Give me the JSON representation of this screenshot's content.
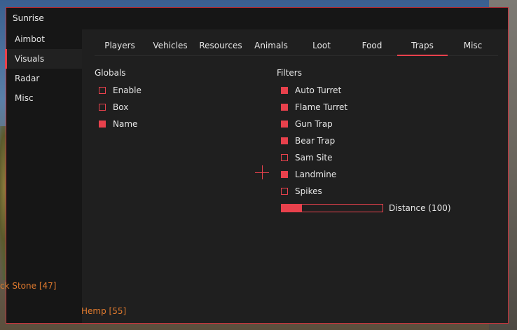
{
  "window": {
    "title": "Sunrise"
  },
  "sidebar": {
    "items": [
      {
        "label": "Aimbot",
        "active": false
      },
      {
        "label": "Visuals",
        "active": true
      },
      {
        "label": "Radar",
        "active": false
      },
      {
        "label": "Misc",
        "active": false
      }
    ]
  },
  "tabs": [
    {
      "label": "Players",
      "active": false
    },
    {
      "label": "Vehicles",
      "active": false
    },
    {
      "label": "Resources",
      "active": false
    },
    {
      "label": "Animals",
      "active": false
    },
    {
      "label": "Loot",
      "active": false
    },
    {
      "label": "Food",
      "active": false
    },
    {
      "label": "Traps",
      "active": true
    },
    {
      "label": "Misc",
      "active": false
    }
  ],
  "globals": {
    "title": "Globals",
    "items": [
      {
        "label": "Enable",
        "checked": false
      },
      {
        "label": "Box",
        "checked": false
      },
      {
        "label": "Name",
        "checked": true
      }
    ]
  },
  "filters": {
    "title": "Filters",
    "items": [
      {
        "label": "Auto Turret",
        "checked": true
      },
      {
        "label": "Flame Turret",
        "checked": true
      },
      {
        "label": "Gun Trap",
        "checked": true
      },
      {
        "label": "Bear Trap",
        "checked": true
      },
      {
        "label": "Sam Site",
        "checked": false
      },
      {
        "label": "Landmine",
        "checked": true
      },
      {
        "label": "Spikes",
        "checked": false
      }
    ],
    "distance": {
      "label": "Distance (100)",
      "fraction": 0.2
    }
  },
  "esp": {
    "stone": "ck Stone [47]",
    "hemp": "Hemp [55]"
  },
  "colors": {
    "accent": "#e8414c",
    "esp": "#e07a2e"
  }
}
